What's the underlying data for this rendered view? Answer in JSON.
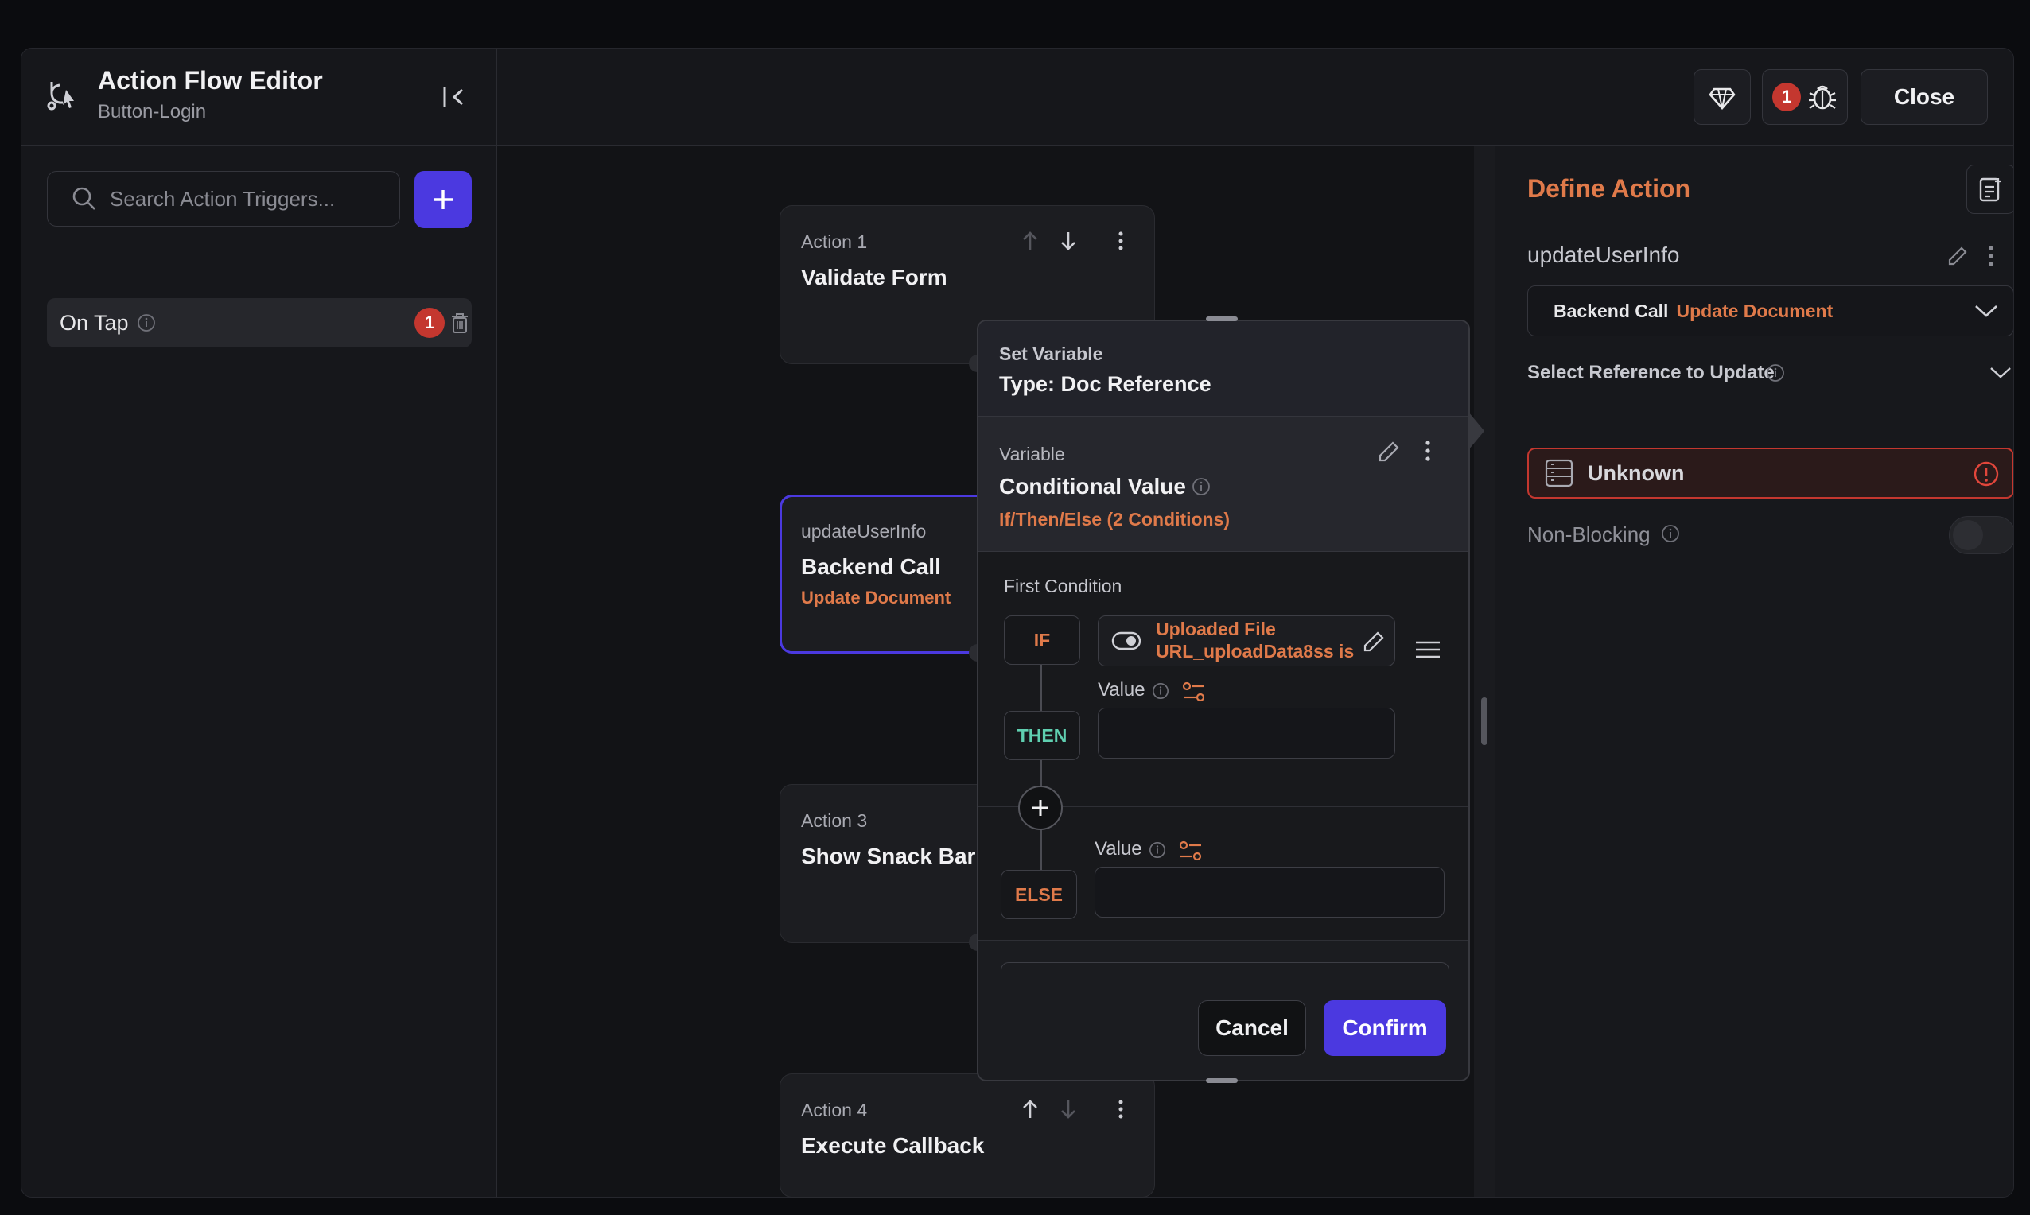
{
  "header": {
    "title": "Action Flow Editor",
    "subtitle": "Button-Login",
    "debug_count": "1",
    "close_label": "Close"
  },
  "sidebar": {
    "search_placeholder": "Search Action Triggers...",
    "trigger_label": "On Tap",
    "trigger_error_count": "1"
  },
  "canvas": {
    "actions": [
      {
        "label": "Action 1",
        "title": "Validate Form"
      },
      {
        "label": "updateUserInfo",
        "title": "Backend Call",
        "subtitle": "Update Document"
      },
      {
        "label": "Action 3",
        "title": "Show Snack Bar"
      },
      {
        "label": "Action 4",
        "title": "Execute Callback"
      }
    ]
  },
  "popover": {
    "set_variable_label": "Set Variable",
    "type_label": "Type: Doc Reference",
    "variable_label": "Variable",
    "conditional_title": "Conditional Value",
    "conditional_subtitle": "If/Then/Else (2 Conditions)",
    "first_condition": "First Condition",
    "if_label": "IF",
    "then_label": "THEN",
    "else_label": "ELSE",
    "condition_text": "Uploaded File URL_uploadData8ss is",
    "value_label": "Value",
    "cancel_label": "Cancel",
    "confirm_label": "Confirm"
  },
  "rightpanel": {
    "title": "Define Action",
    "action_name": "updateUserInfo",
    "action_type": "Backend Call",
    "action_subtype": "Update Document",
    "reference_label": "Select Reference to Update",
    "reference_value": "Unknown",
    "non_blocking_label": "Non-Blocking"
  },
  "colors": {
    "accent": "#4b39e0",
    "orange": "#e07a4a",
    "error": "#c4372f",
    "then_green": "#5fcfb0"
  }
}
